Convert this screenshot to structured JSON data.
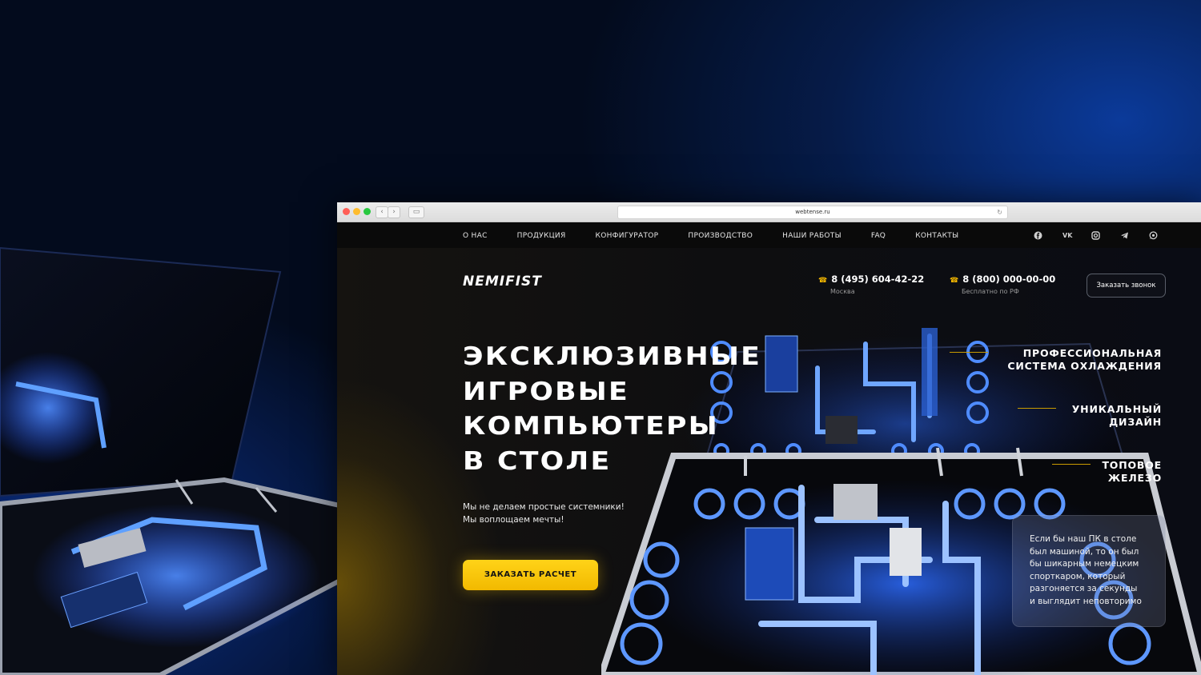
{
  "browser": {
    "url": "webtense.ru"
  },
  "nav": {
    "items": [
      "О НАС",
      "ПРОДУКЦИЯ",
      "КОНФИГУРАТОР",
      "ПРОИЗВОДСТВО",
      "НАШИ РАБОТЫ",
      "FAQ",
      "КОНТАКТЫ"
    ],
    "social_icons": [
      "facebook-icon",
      "vk-icon",
      "instagram-icon",
      "telegram-icon",
      "whatsapp-icon"
    ],
    "vk_text": "VK"
  },
  "header": {
    "logo": "NEMIFIST",
    "phone1": {
      "number": "8 (495) 604-42-22",
      "label": "Москва"
    },
    "phone2": {
      "number": "8 (800) 000-00-00",
      "label": "Бесплатно по РФ"
    },
    "call_button": "Заказать звонок"
  },
  "hero": {
    "headline": [
      "ЭКСКЛЮЗИВНЫЕ",
      "ИГРОВЫЕ",
      "КОМПЬЮТЕРЫ",
      "В СТОЛЕ"
    ],
    "lead": [
      "Мы не делаем простые системники!",
      "Мы воплощаем мечты!"
    ],
    "cta": "ЗАКАЗАТЬ РАСЧЕТ",
    "features": [
      [
        "ПРОФЕССИОНАЛЬНАЯ",
        "СИСТЕМА ОХЛАЖДЕНИЯ"
      ],
      [
        "УНИКАЛЬНЫЙ",
        "ДИЗАЙН"
      ],
      [
        "ТОПОВОЕ",
        "ЖЕЛЕЗО"
      ]
    ],
    "quote": "Если бы наш ПК в столе\nбыл машиной, то он был\nбы шикарным немецким\nспорткаром, который\nразгоняется за секунды\nи выглядит неповторимо"
  },
  "colors": {
    "accent": "#f5b800",
    "neon": "#1e6bff"
  }
}
